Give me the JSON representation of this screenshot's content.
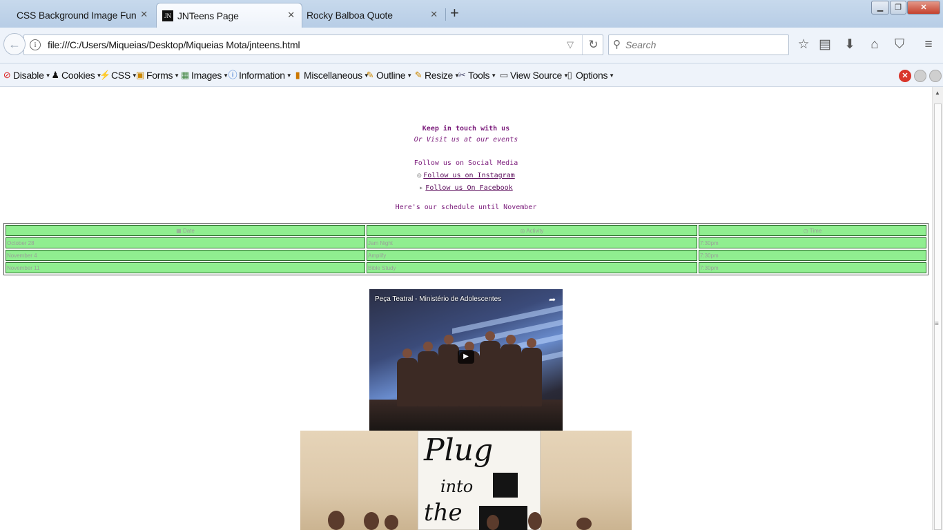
{
  "tabs": [
    {
      "label": "CSS Background Image Fun",
      "active": false
    },
    {
      "label": "JNTeens Page",
      "active": true,
      "favicon": "JN"
    },
    {
      "label": "Rocky Balboa Quote",
      "active": false
    }
  ],
  "navbar": {
    "url": "file:///C:/Users/Miqueias/Desktop/Miqueias Mota/jnteens.html",
    "search_placeholder": "Search"
  },
  "devtoolbar": {
    "items": [
      "Disable",
      "Cookies",
      "CSS",
      "Forms",
      "Images",
      "Information",
      "Miscellaneous",
      "Outline",
      "Resize",
      "Tools",
      "View Source",
      "Options"
    ]
  },
  "page": {
    "keep_in_touch": "Keep in touch with us",
    "visit": "Or Visit us at our events",
    "follow_social": "Follow us on Social Media",
    "instagram": "Follow us on Instagram",
    "facebook": "Follow us On Facebook",
    "schedule_intro": "Here's our schedule until November",
    "table": {
      "headers": [
        "Date",
        "Activity",
        "Time"
      ],
      "rows": [
        [
          "October 28",
          "Jam Night",
          "7:30pm"
        ],
        [
          "November 4",
          "Amplify",
          "7:30pm"
        ],
        [
          "November 11",
          "Bible Study",
          "7:30pm"
        ]
      ]
    },
    "video_title": "Peça Teatral - Ministério de Adolescentes"
  },
  "colors": {
    "text_purple": "#7a1a7a",
    "table_green": "#90ee90"
  }
}
